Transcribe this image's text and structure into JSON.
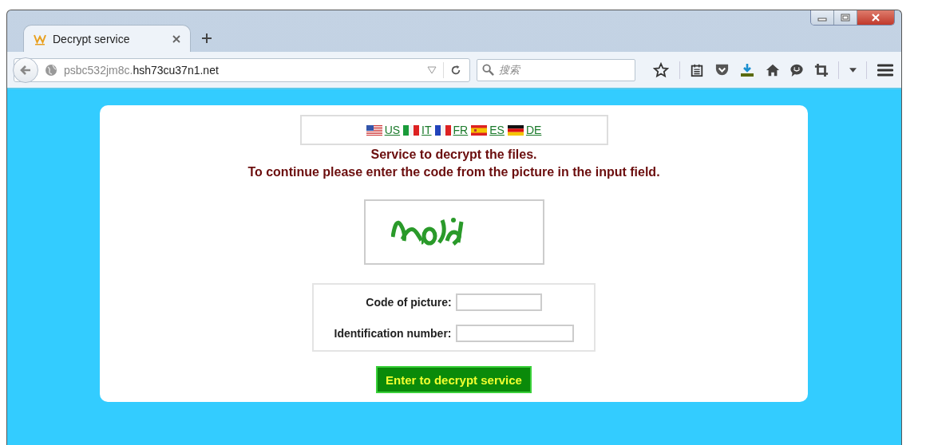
{
  "tab": {
    "title": "Decrypt service",
    "selected": true
  },
  "address_bar": {
    "url": "psbc532jm8c.hsh73cu37n1.net"
  },
  "search": {
    "placeholder": "搜索"
  },
  "languages": [
    {
      "label": "US"
    },
    {
      "label": "IT"
    },
    {
      "label": "FR"
    },
    {
      "label": "ES"
    },
    {
      "label": "DE"
    }
  ],
  "heading": "Service to decrypt the files.",
  "instruction": "To continue please enter the code from the picture in the input field.",
  "form": {
    "fields": [
      {
        "label": "Code of picture:"
      },
      {
        "label": "Identification number:"
      }
    ],
    "submit": "Enter to decrypt service"
  }
}
